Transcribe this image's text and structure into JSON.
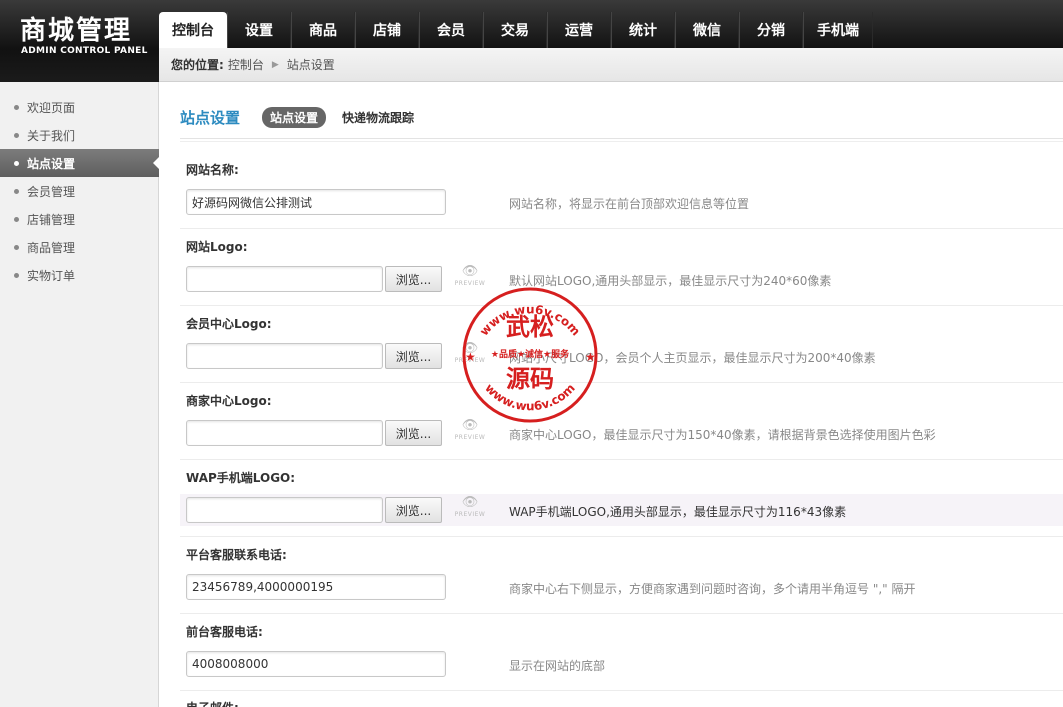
{
  "header": {
    "logo_title": "商城管理",
    "logo_subtitle": "ADMIN CONTROL PANEL",
    "nav": [
      "控制台",
      "设置",
      "商品",
      "店铺",
      "会员",
      "交易",
      "运营",
      "统计",
      "微信",
      "分销",
      "手机端"
    ],
    "active_nav_index": 0
  },
  "breadcrumb": {
    "label": "您的位置:",
    "items": [
      "控制台",
      "站点设置"
    ],
    "separator": "▶"
  },
  "sidebar": {
    "items": [
      "欢迎页面",
      "关于我们",
      "站点设置",
      "会员管理",
      "店铺管理",
      "商品管理",
      "实物订单"
    ],
    "active_index": 2
  },
  "main": {
    "title": "站点设置",
    "tabs": [
      "站点设置",
      "快递物流跟踪"
    ],
    "active_tab_index": 0,
    "browse_label": "浏览...",
    "preview_label": "PREVIEW",
    "fields": [
      {
        "label": "网站名称:",
        "type": "text",
        "value": "好源码网微信公排测试",
        "hint": "网站名称，将显示在前台顶部欢迎信息等位置"
      },
      {
        "label": "网站Logo:",
        "type": "file",
        "value": "",
        "hint": "默认网站LOGO,通用头部显示，最佳显示尺寸为240*60像素"
      },
      {
        "label": "会员中心Logo:",
        "type": "file",
        "value": "",
        "hint": "网站小尺寸LOGO，会员个人主页显示，最佳显示尺寸为200*40像素"
      },
      {
        "label": "商家中心Logo:",
        "type": "file",
        "value": "",
        "hint": "商家中心LOGO，最佳显示尺寸为150*40像素，请根据背景色选择使用图片色彩"
      },
      {
        "label": "WAP手机端LOGO:",
        "type": "file",
        "value": "",
        "hint": "WAP手机端LOGO,通用头部显示，最佳显示尺寸为116*43像素"
      },
      {
        "label": "平台客服联系电话:",
        "type": "text",
        "value": "23456789,4000000195",
        "hint": "商家中心右下侧显示，方便商家遇到问题时咨询，多个请用半角逗号 \",\" 隔开"
      },
      {
        "label": "前台客服电话:",
        "type": "text",
        "value": "4008008000",
        "hint": "显示在网站的底部"
      }
    ],
    "partial_label": "电子邮件:"
  },
  "watermark": {
    "url_top": "www.wu6v.com",
    "url_bottom": "www.wu6v.com",
    "line1": "武松",
    "slogan": "★品质★诚信★服务",
    "line2": "源码",
    "color": "#d61f1f"
  },
  "colors": {
    "title_blue": "#2d8bc0",
    "header_dark": "#1b1b1b",
    "sidebar_active": "#666666"
  }
}
